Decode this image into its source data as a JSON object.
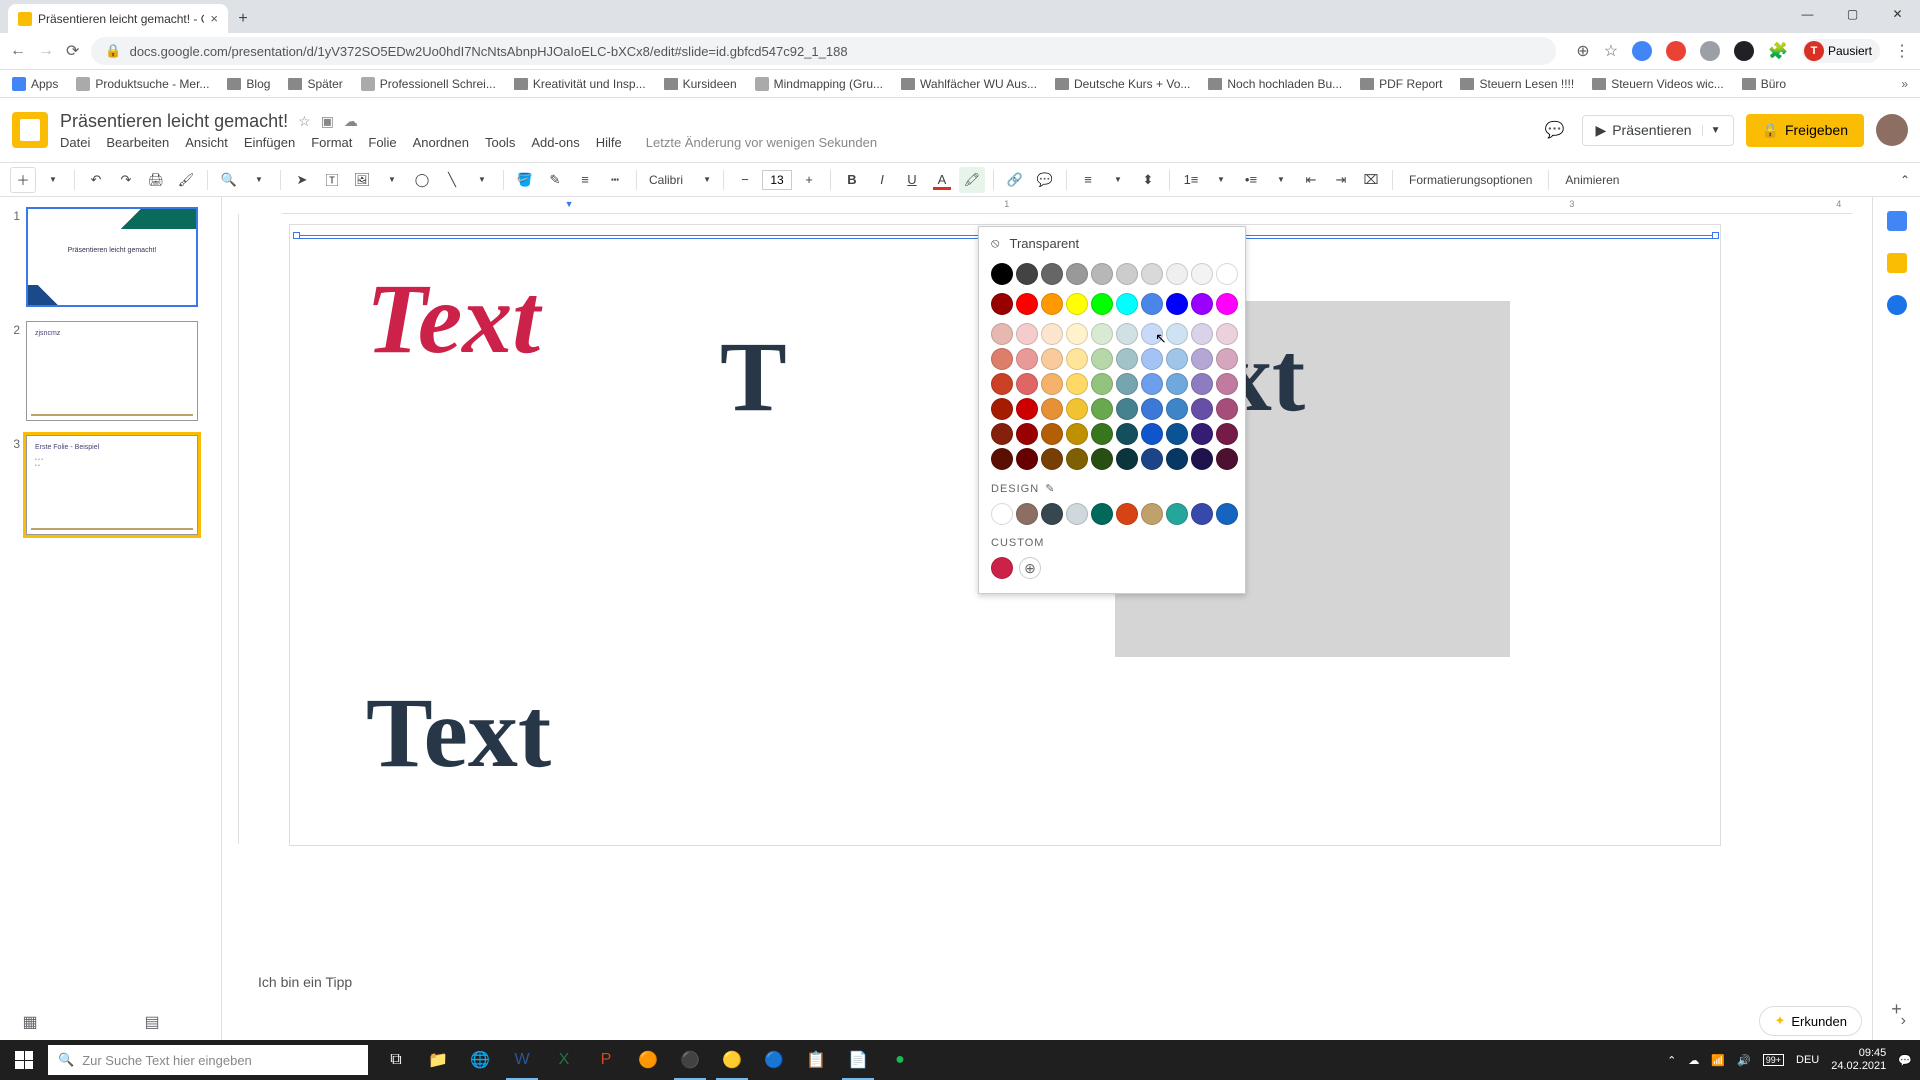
{
  "browser": {
    "tab_title": "Präsentieren leicht gemacht! - G",
    "url": "docs.google.com/presentation/d/1yV372SO5EDw2Uo0hdI7NcNtsAbnpHJOaIoELC-bXCx8/edit#slide=id.gbfcd547c92_1_188",
    "profile_label": "Pausiert",
    "profile_initial": "T"
  },
  "bookmarks": {
    "apps": "Apps",
    "items": [
      "Produktsuche - Mer...",
      "Blog",
      "Später",
      "Professionell Schrei...",
      "Kreativität und Insp...",
      "Kursideen",
      "Mindmapping  (Gru...",
      "Wahlfächer WU Aus...",
      "Deutsche Kurs + Vo...",
      "Noch hochladen Bu...",
      "PDF Report",
      "Steuern Lesen !!!!",
      "Steuern Videos wic...",
      "Büro"
    ]
  },
  "doc": {
    "title": "Präsentieren leicht gemacht!",
    "menus": [
      "Datei",
      "Bearbeiten",
      "Ansicht",
      "Einfügen",
      "Format",
      "Folie",
      "Anordnen",
      "Tools",
      "Add-ons",
      "Hilfe"
    ],
    "last_edit": "Letzte Änderung vor wenigen Sekunden",
    "present": "Präsentieren",
    "share": "Freigeben"
  },
  "toolbar": {
    "font_name": "Calibri",
    "font_size": "13",
    "format_options": "Formatierungsoptionen",
    "animate": "Animieren"
  },
  "ruler": {
    "mark1": "1",
    "mark2": "3",
    "mark3": "4"
  },
  "slides": {
    "n1": "1",
    "t1": "Präsentieren leicht gemacht!",
    "n2": "2",
    "t2": "zjsncmz",
    "n3": "3",
    "t3": "Erste Folie - Beispiel"
  },
  "canvas": {
    "text1": "Text",
    "text2": "T",
    "text3": "Text",
    "text4": "Text",
    "hint": "Ich bin ein Tipp"
  },
  "color_picker": {
    "transparent": "Transparent",
    "design_label": "DESIGN",
    "custom_label": "CUSTOM",
    "row_gray": [
      "#000000",
      "#434343",
      "#666666",
      "#999999",
      "#b7b7b7",
      "#cccccc",
      "#d9d9d9",
      "#efefef",
      "#f3f3f3",
      "#ffffff"
    ],
    "row_main": [
      "#980000",
      "#ff0000",
      "#ff9900",
      "#ffff00",
      "#00ff00",
      "#00ffff",
      "#4a86e8",
      "#0000ff",
      "#9900ff",
      "#ff00ff"
    ],
    "shades": [
      [
        "#e6b8af",
        "#f4cccc",
        "#fce5cd",
        "#fff2cc",
        "#d9ead3",
        "#d0e0e3",
        "#c9daf8",
        "#cfe2f3",
        "#d9d2e9",
        "#ead1dc"
      ],
      [
        "#dd7e6b",
        "#ea9999",
        "#f9cb9c",
        "#ffe599",
        "#b6d7a8",
        "#a2c4c9",
        "#a4c2f4",
        "#9fc5e8",
        "#b4a7d6",
        "#d5a6bd"
      ],
      [
        "#cc4125",
        "#e06666",
        "#f6b26b",
        "#ffd966",
        "#93c47d",
        "#76a5af",
        "#6d9eeb",
        "#6fa8dc",
        "#8e7cc3",
        "#c27ba0"
      ],
      [
        "#a61c00",
        "#cc0000",
        "#e69138",
        "#f1c232",
        "#6aa84f",
        "#45818e",
        "#3c78d8",
        "#3d85c6",
        "#674ea7",
        "#a64d79"
      ],
      [
        "#85200c",
        "#990000",
        "#b45f06",
        "#bf9000",
        "#38761d",
        "#134f5c",
        "#1155cc",
        "#0b5394",
        "#351c75",
        "#741b47"
      ],
      [
        "#5b0f00",
        "#660000",
        "#783f04",
        "#7f6000",
        "#274e13",
        "#0c343d",
        "#1c4587",
        "#073763",
        "#20124d",
        "#4c1130"
      ]
    ],
    "design_row": [
      "#ffffff",
      "#8d6e63",
      "#37474f",
      "#cfd8dc",
      "#00695c",
      "#d84315",
      "#c0a16b",
      "#26a69a",
      "#3949ab",
      "#1565c0"
    ],
    "custom_color": "#cc2149"
  },
  "explore": {
    "label": "Erkunden"
  },
  "taskbar": {
    "search_placeholder": "Zur Suche Text hier eingeben",
    "bat": "99+",
    "lang": "DEU",
    "time": "09:45",
    "date": "24.02.2021"
  }
}
